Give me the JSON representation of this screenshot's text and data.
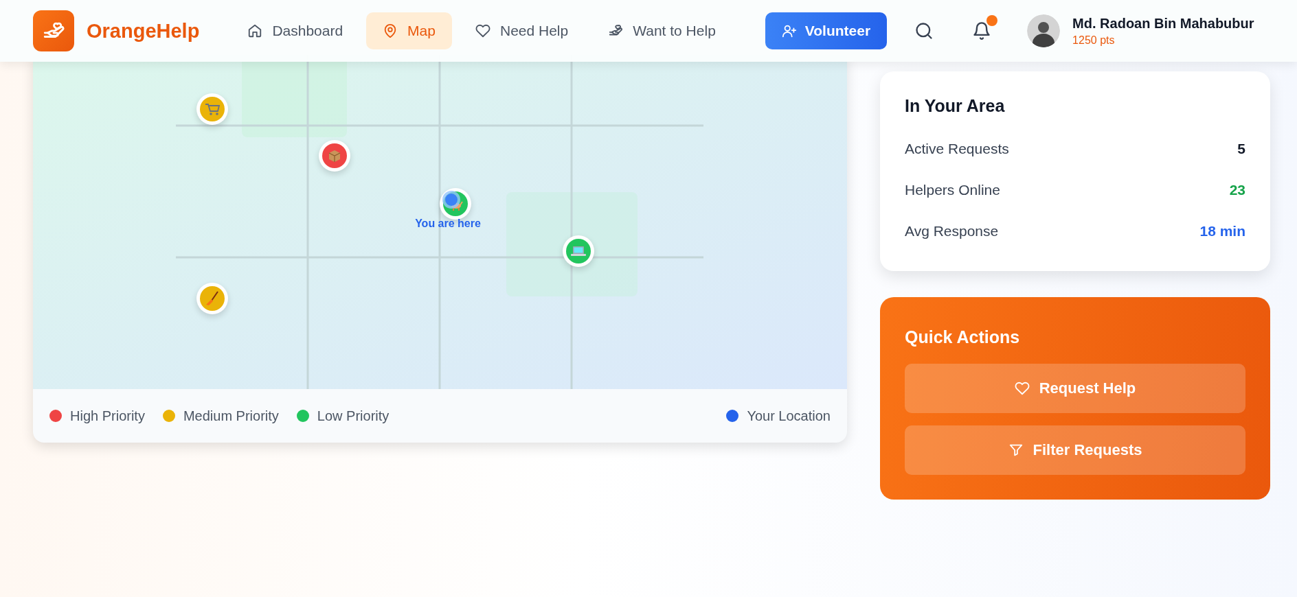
{
  "header": {
    "logo_text": "OrangeHelp",
    "nav": [
      {
        "label": "Dashboard",
        "selected": false
      },
      {
        "label": "Map",
        "selected": true
      },
      {
        "label": "Need Help",
        "selected": false
      },
      {
        "label": "Want to Help",
        "selected": false
      }
    ],
    "volunteer_button": "Volunteer",
    "has_notification": true,
    "user": {
      "name": "Md. Radoan Bin Mahabubur",
      "points": "1250 pts"
    }
  },
  "map": {
    "pins": [
      {
        "kind": "cart",
        "color": "#eab308"
      },
      {
        "kind": "box",
        "color": "#ef4444"
      },
      {
        "kind": "pet",
        "color": "#22c55e"
      },
      {
        "kind": "laptop",
        "color": "#22c55e"
      },
      {
        "kind": "broom",
        "color": "#eab308"
      }
    ],
    "you_are_here": "You are here",
    "legend": [
      {
        "label": "High Priority",
        "color": "#ef4444"
      },
      {
        "label": "Medium Priority",
        "color": "#eab308"
      },
      {
        "label": "Low Priority",
        "color": "#22c55e"
      },
      {
        "label": "Your Location",
        "color": "#2563eb"
      }
    ]
  },
  "area": {
    "title": "In Your Area",
    "stats": [
      {
        "label": "Active Requests",
        "value": "5",
        "color": "#111827"
      },
      {
        "label": "Helpers Online",
        "value": "23",
        "color": "#16a34a"
      },
      {
        "label": "Avg Response",
        "value": "18 min",
        "color": "#2563eb"
      }
    ]
  },
  "quick_actions": {
    "title": "Quick Actions",
    "buttons": [
      {
        "label": "Request Help"
      },
      {
        "label": "Filter Requests"
      }
    ]
  }
}
